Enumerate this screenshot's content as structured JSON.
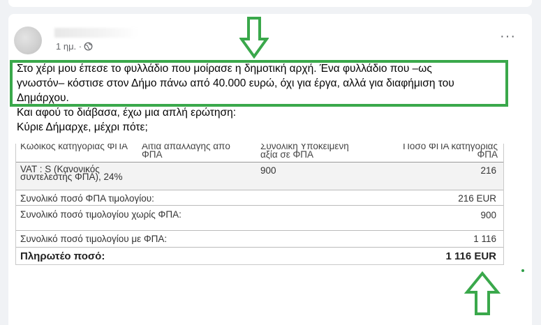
{
  "post": {
    "time_label": "1 ημ. ·",
    "privacy_icon": "globe-icon",
    "more_label": "···",
    "text_line1": "Στο χέρι μου έπεσε το φυλλάδιο που μοίρασε η δημοτική αρχή. Ένα φυλλάδιο που –ως",
    "text_line2": "γνωστόν– κόστισε στον Δήμο πάνω από 40.000 ευρώ, όχι για έργα, αλλά για διαφήμιση του",
    "text_line3": "Δημάρχου.",
    "text_line4": "Και αφού το διάβασα, έχω μια απλή ερώτηση:",
    "text_line5": "Κύριε Δήμαρχε, μέχρι πότε;"
  },
  "invoice": {
    "headers": {
      "col1": "Κωδικός κατηγορίας ΦΠΑ",
      "col2": "Αιτία απαλλαγής από ΦΠΑ",
      "col3": "Συνολική Υποκείμενη αξία σε ΦΠΑ",
      "col4": "Ποσό ΦΠΑ κατηγορίας ΦΠΑ"
    },
    "vat_row": {
      "code": "VAT : S (Κανονικός συντελεστής ΦΠΑ), 24%",
      "base": "900",
      "vat": "216"
    },
    "rows": [
      {
        "label": "Συνολικό ποσό ΦΠΑ τιμολογίου:",
        "value": "216 EUR"
      },
      {
        "label": "Συνολικό ποσό τιμολογίου χωρίς ΦΠΑ:",
        "value": "900"
      },
      {
        "label": "Συνολικό ποσό τιμολογίου με ΦΠΑ:",
        "value": "1 116"
      },
      {
        "label": "Πληρωτέο ποσό:",
        "value": "1 116 EUR"
      }
    ]
  },
  "annotations": {
    "arrow_color": "#3aa84b",
    "highlight_color": "#3aa84b"
  }
}
